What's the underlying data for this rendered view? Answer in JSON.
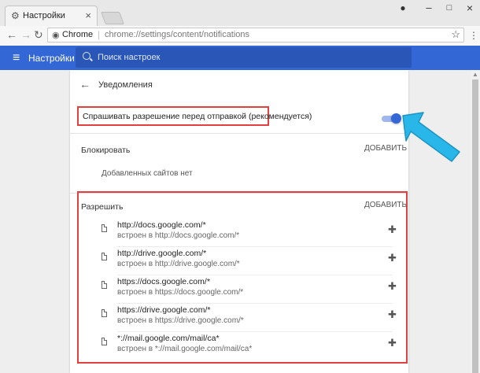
{
  "browser": {
    "tab_title": "Настройки",
    "tab_icon": "gear-icon",
    "tab_close": "×",
    "omnibox_chrome": "Chrome",
    "omnibox_url": "chrome://settings/content/notifications",
    "window_buttons": {
      "minimize": "–",
      "maximize": "□",
      "close": "×"
    }
  },
  "header": {
    "title": "Настройки",
    "search_placeholder": "Поиск настроек",
    "color": "#3367d6"
  },
  "page": {
    "title": "Уведомления",
    "ask_label": "Спрашивать разрешение перед отправкой (рекомендуется)",
    "ask_enabled": true,
    "block": {
      "label": "Блокировать",
      "add_label": "ДОБАВИТЬ",
      "empty_text": "Добавленных сайтов нет"
    },
    "allow": {
      "label": "Разрешить",
      "add_label": "ДОБАВИТЬ",
      "sites": [
        {
          "url": "http://docs.google.com/*",
          "embedded": "встроен в http://docs.google.com/*"
        },
        {
          "url": "http://drive.google.com/*",
          "embedded": "встроен в http://drive.google.com/*"
        },
        {
          "url": "https://docs.google.com/*",
          "embedded": "встроен в https://docs.google.com/*"
        },
        {
          "url": "https://drive.google.com/*",
          "embedded": "встроен в https://drive.google.com/*"
        },
        {
          "url": "*://mail.google.com/mail/ca*",
          "embedded": "встроен в *://mail.google.com/mail/ca*"
        }
      ]
    }
  },
  "annotation": {
    "arrow_color": "#29b6e8",
    "highlight_color": "#e04040"
  }
}
